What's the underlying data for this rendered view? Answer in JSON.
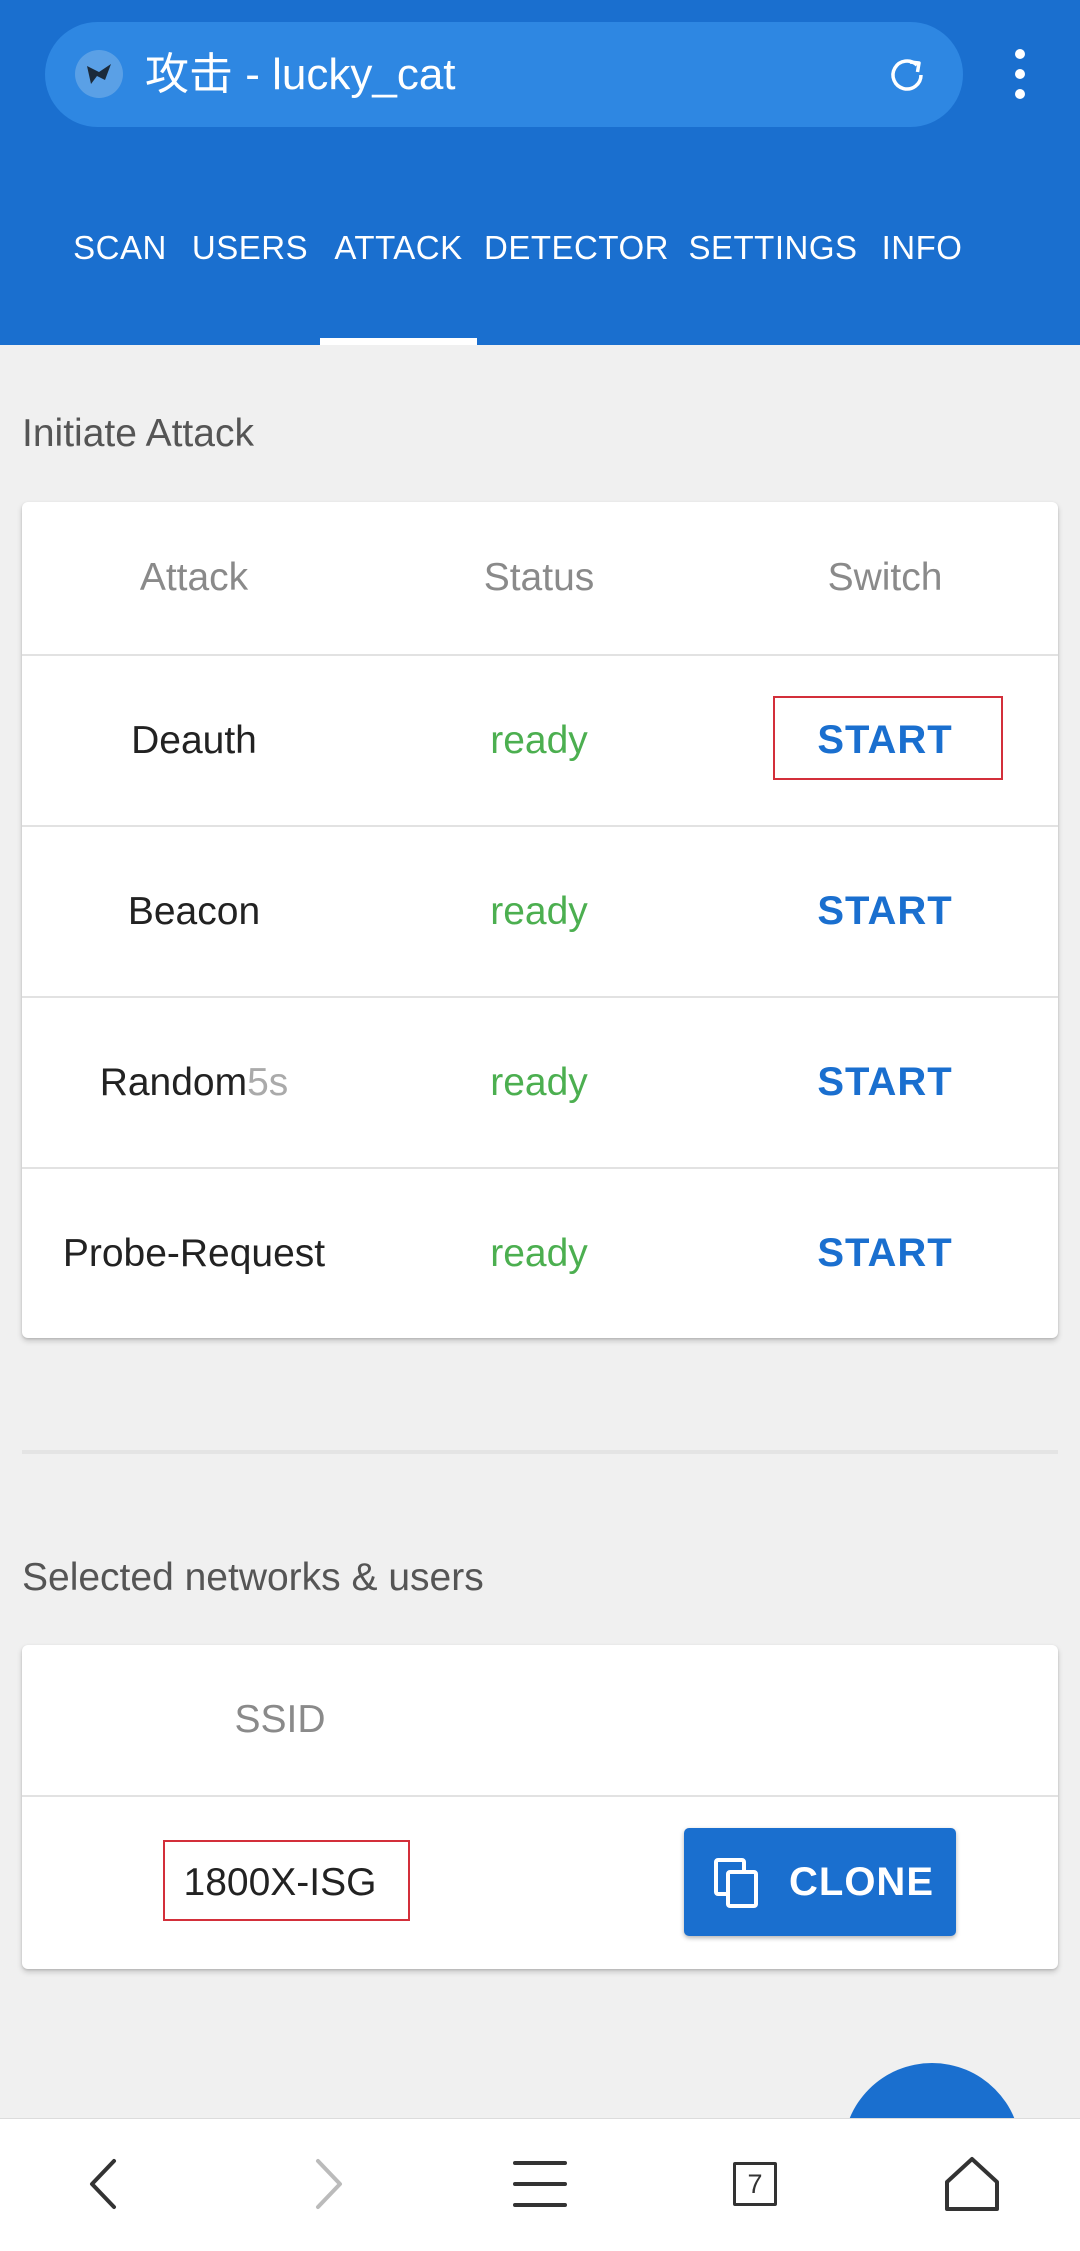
{
  "browser": {
    "page_title": "攻击 - lucky_cat",
    "open_tabs_count": "7"
  },
  "tabs": [
    {
      "label": "SCAN"
    },
    {
      "label": "USERS"
    },
    {
      "label": "ATTACK",
      "active": true
    },
    {
      "label": "DETECTOR"
    },
    {
      "label": "SETTINGS"
    },
    {
      "label": "INFO"
    }
  ],
  "attack_section": {
    "title": "Initiate Attack",
    "headers": {
      "attack": "Attack",
      "status": "Status",
      "switch": "Switch"
    },
    "rows": [
      {
        "name": "Deauth",
        "timer": "",
        "status": "ready",
        "button": "START",
        "highlighted": true
      },
      {
        "name": "Beacon",
        "timer": "",
        "status": "ready",
        "button": "START"
      },
      {
        "name": "Random",
        "timer": "5s",
        "status": "ready",
        "button": "START"
      },
      {
        "name": "Probe-Request",
        "timer": "",
        "status": "ready",
        "button": "START"
      }
    ]
  },
  "selected_section": {
    "title": "Selected networks & users",
    "header_ssid": "SSID",
    "rows": [
      {
        "ssid": "1800X-ISG",
        "button": "CLONE",
        "highlighted": true
      }
    ]
  },
  "colors": {
    "primary": "#1a6fcf",
    "ready": "#4caf50",
    "highlight_border": "#d32f3a",
    "background": "#f0f0f0"
  },
  "icons": {
    "site": "shield-favicon-icon",
    "reload": "reload-icon",
    "menu": "more-vert-icon",
    "copy": "copy-icon",
    "back": "chevron-left-icon",
    "forward": "chevron-right-icon",
    "nav_menu": "hamburger-icon",
    "home": "home-icon"
  }
}
